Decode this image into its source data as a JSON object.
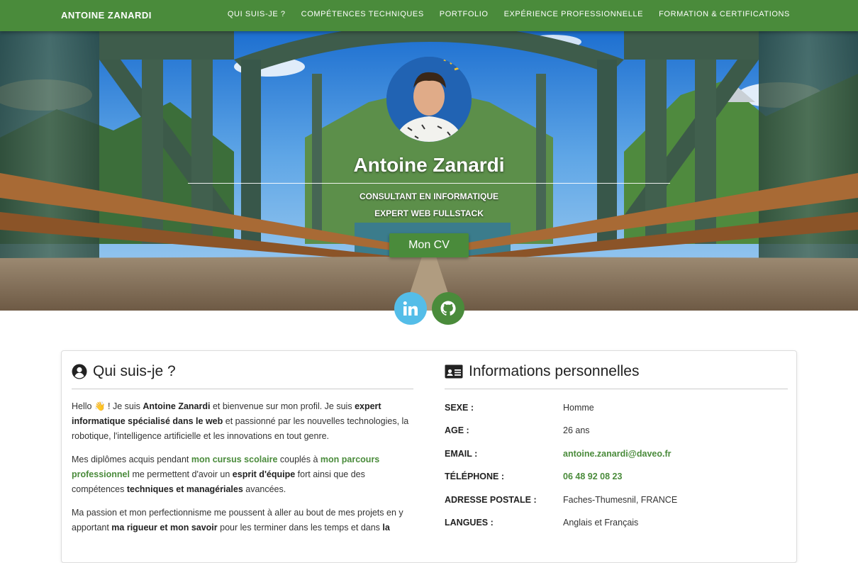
{
  "nav": {
    "brand": "ANTOINE ZANARDI",
    "links": [
      "QUI SUIS-JE ?",
      "COMPÉTENCES TECHNIQUES",
      "PORTFOLIO",
      "EXPÉRIENCE PROFESSIONNELLE",
      "FORMATION & CERTIFICATIONS"
    ]
  },
  "hero": {
    "name": "Antoine Zanardi",
    "subtitle_1": "CONSULTANT EN INFORMATIQUE",
    "subtitle_2": "EXPERT WEB FULLSTACK",
    "cv_button": "Mon CV",
    "social": [
      "linkedin-icon",
      "github-icon"
    ]
  },
  "about": {
    "title": "Qui suis-je ?",
    "p1": {
      "a": "Hello 👋 ! Je suis ",
      "b": "Antoine Zanardi",
      "c": " et bienvenue sur mon profil. Je suis ",
      "d": "expert informatique spécialisé dans le web",
      "e": " et passionné par les nouvelles technologies, la robotique, l'intelligence artificielle et les innovations en tout genre."
    },
    "p2": {
      "a": "Mes diplômes acquis pendant ",
      "b": "mon cursus scolaire",
      "c": " couplés à ",
      "d": "mon parcours professionnel",
      "e": " me permettent d'avoir un ",
      "f": "esprit d'équipe",
      "g": " fort ainsi que des compétences ",
      "h": "techniques et managériales",
      "i": " avancées."
    },
    "p3": {
      "a": "Ma passion et mon perfectionnisme me poussent à aller au bout de mes projets en y apportant ",
      "b": "ma rigueur et mon savoir",
      "c": " pour les terminer dans les temps et dans ",
      "d": "la"
    }
  },
  "info": {
    "title": "Informations personnelles",
    "rows": [
      {
        "label": "SEXE :",
        "value": "Homme"
      },
      {
        "label": "AGE :",
        "value": "26 ans"
      },
      {
        "label": "EMAIL :",
        "value": "antoine.zanardi@daveo.fr"
      },
      {
        "label": "TÉLÉPHONE :",
        "value": "06 48 92 08 23"
      },
      {
        "label": "ADRESSE POSTALE :",
        "value": "Faches-Thumesnil, FRANCE"
      },
      {
        "label": "LANGUES :",
        "value": "Anglais et Français"
      }
    ]
  },
  "colors": {
    "accent": "#4a8b3b",
    "linkedin": "#54bde8"
  }
}
